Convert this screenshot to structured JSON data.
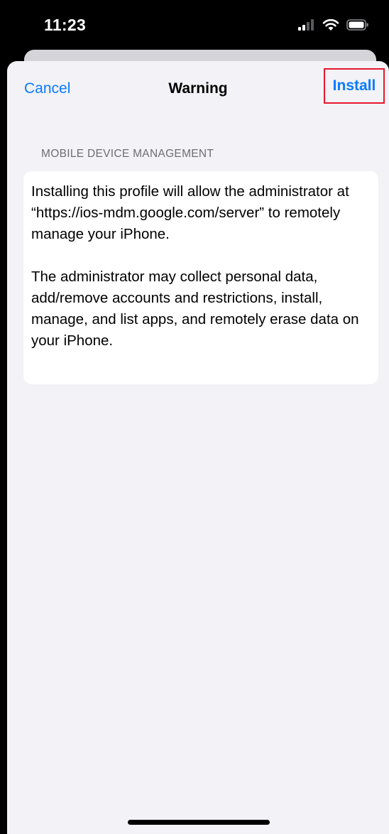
{
  "status_bar": {
    "time": "11:23",
    "icons": [
      "cellular-signal-icon",
      "wifi-icon",
      "battery-icon"
    ]
  },
  "nav": {
    "cancel_label": "Cancel",
    "title": "Warning",
    "install_label": "Install"
  },
  "section": {
    "header": "MOBILE DEVICE MANAGEMENT",
    "paragraphs": [
      "Installing this profile will allow the administrator at “https://ios-mdm.google.com/server” to remotely manage your iPhone.",
      "The administrator may collect personal data, add/remove accounts and restrictions, install, manage, and list apps, and remotely erase data on your iPhone."
    ]
  },
  "colors": {
    "accent": "#0a7aff",
    "highlight_border": "#e8172c",
    "sheet_background": "#f2f2f7",
    "card_background": "#ffffff",
    "secondary_text": "#6d6d72"
  }
}
